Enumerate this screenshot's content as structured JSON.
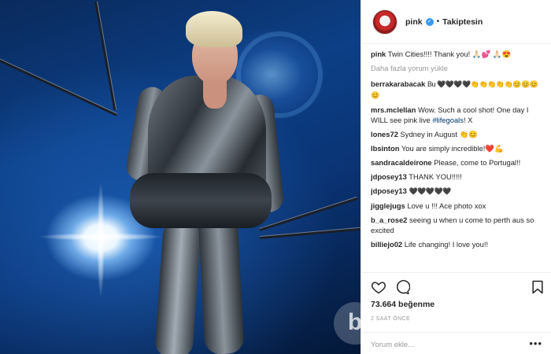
{
  "post": {
    "username": "pink",
    "follow_status": "Takiptesin",
    "separator": "•"
  },
  "comments": {
    "load_more": "Daha fazla yorum yükle",
    "items": [
      {
        "user": "pink",
        "text": "Twin Cities!!!! Thank you! 🙏🏻💕 🙏🏻😍"
      },
      {
        "user": "berrakarabacak",
        "text": "Bu 🖤🖤🖤🖤👏👏👏👏👏😊😊😊😊"
      },
      {
        "user": "mrs.mclellan",
        "text": "Wow. Such a cool shot! One day I WILL see pink live",
        "hashtag": "#lifegoals",
        "after": "! X"
      },
      {
        "user": "lones72",
        "text": "Sydney in August 👏😊"
      },
      {
        "user": "lbsinton",
        "text": "You are simply incredible!❤️💪"
      },
      {
        "user": "sandracaldeirone",
        "text": "Please, come to Portugal!!"
      },
      {
        "user": "jdposey13",
        "text": "THANK YOU!!!!!"
      },
      {
        "user": "jdposey13",
        "text": "🖤🖤🖤🖤🖤"
      },
      {
        "user": "jigglejugs",
        "text": "Love u !!! Ace photo xox"
      },
      {
        "user": "b_a_rose2",
        "text": "seeing u when u come to perth aus so excited"
      },
      {
        "user": "billiejo02",
        "text": "Life changing! I love you!!"
      }
    ]
  },
  "actions": {
    "likes": "73.664 beğenme",
    "timestamp": "2 SAAT ÖNCE",
    "comment_placeholder": "Yorum ekle...",
    "more": "•••"
  },
  "watermark": "b",
  "colors": {
    "link": "#003569",
    "verified": "#3897f0",
    "muted": "#999999"
  },
  "icons": [
    "heart-icon",
    "comment-icon",
    "bookmark-icon",
    "verified-icon",
    "more-icon"
  ]
}
